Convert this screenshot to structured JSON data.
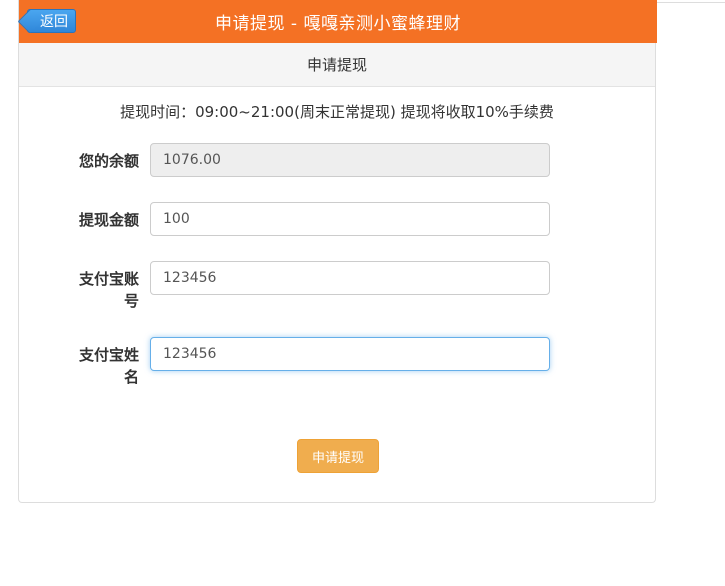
{
  "header": {
    "back_label": "返回",
    "title": "申请提现 - 嘎嘎亲测小蜜蜂理财",
    "accent_color": "#f47124",
    "back_color": "#3a95e3"
  },
  "panel": {
    "heading": "申请提现"
  },
  "notice": "提现时间：09:00~21:00(周末正常提现) 提现将收取10%手续费",
  "form": {
    "balance": {
      "label": "您的余额",
      "value": "1076.00"
    },
    "amount": {
      "label": "提现金额",
      "value": "100"
    },
    "alipay_account": {
      "label_line1": "支付宝账",
      "label_line2": "号",
      "value": "123456"
    },
    "alipay_name": {
      "label_line1": "支付宝姓",
      "label_line2": "名",
      "value": "123456"
    },
    "submit_label": "申请提现",
    "submit_color": "#f0ad4e"
  }
}
